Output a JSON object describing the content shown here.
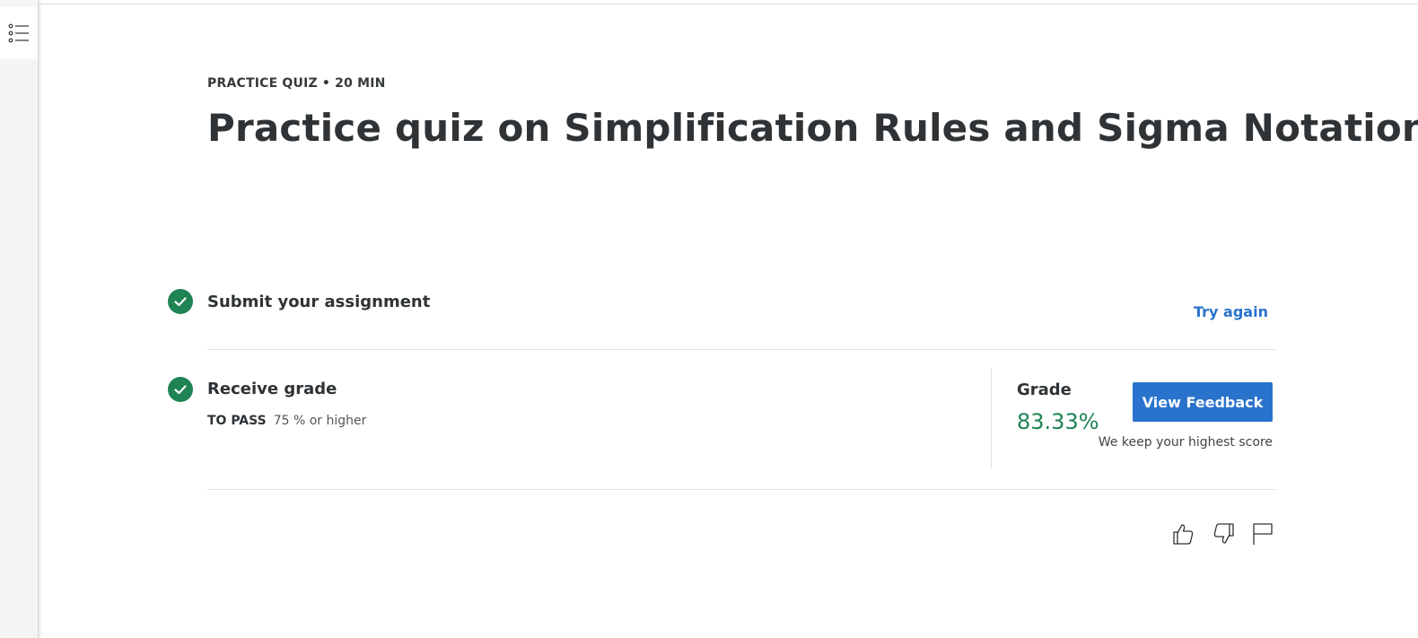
{
  "sidebar": {
    "toggle_icon": "list-icon"
  },
  "header": {
    "eyebrow": "PRACTICE QUIZ • 20 MIN",
    "title": "Practice quiz on Simplification Rules and Sigma Notation"
  },
  "steps": [
    {
      "title": "Submit your assignment",
      "status": "complete",
      "action_label": "Try again"
    },
    {
      "title": "Receive grade",
      "status": "complete",
      "pass_label": "TO PASS",
      "pass_value": "75 % or higher"
    }
  ],
  "grade": {
    "label": "Grade",
    "value": "83.33%",
    "button_label": "View Feedback",
    "note": "We keep your highest score"
  },
  "feedback": {
    "icons": [
      "thumbs-up-icon",
      "thumbs-down-icon",
      "flag-icon"
    ]
  },
  "colors": {
    "accent": "#2a73cc",
    "success": "#1f8354",
    "text": "#2f3336"
  }
}
